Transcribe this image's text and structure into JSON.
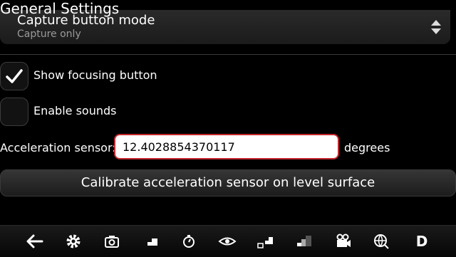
{
  "header": {
    "title": "General Settings"
  },
  "capture_mode": {
    "label": "Capture button mode",
    "value": "Capture only"
  },
  "options": [
    {
      "label": "Show focusing button",
      "checked": true
    },
    {
      "label": "Enable sounds",
      "checked": false
    }
  ],
  "acceleration": {
    "label": "Acceleration sensor:",
    "value": "12.4028854370117",
    "unit": "degrees"
  },
  "calibrate_button": {
    "label": "Calibrate acceleration sensor on level surface"
  },
  "toolbar": {
    "items": [
      {
        "icon": "back-arrow-icon"
      },
      {
        "icon": "gear-icon"
      },
      {
        "icon": "camera-icon"
      },
      {
        "icon": "stairs-icon"
      },
      {
        "icon": "timer-icon"
      },
      {
        "icon": "eye-icon"
      },
      {
        "icon": "stairs-camera-icon"
      },
      {
        "icon": "gradient-stairs-icon"
      },
      {
        "icon": "video-camera-icon"
      },
      {
        "icon": "globe-icon"
      },
      {
        "icon": "d-letter-icon",
        "text": "D"
      }
    ]
  },
  "colors": {
    "background": "#000000",
    "input_border": "#c2272d",
    "secondary_text": "#9a9a9a"
  }
}
